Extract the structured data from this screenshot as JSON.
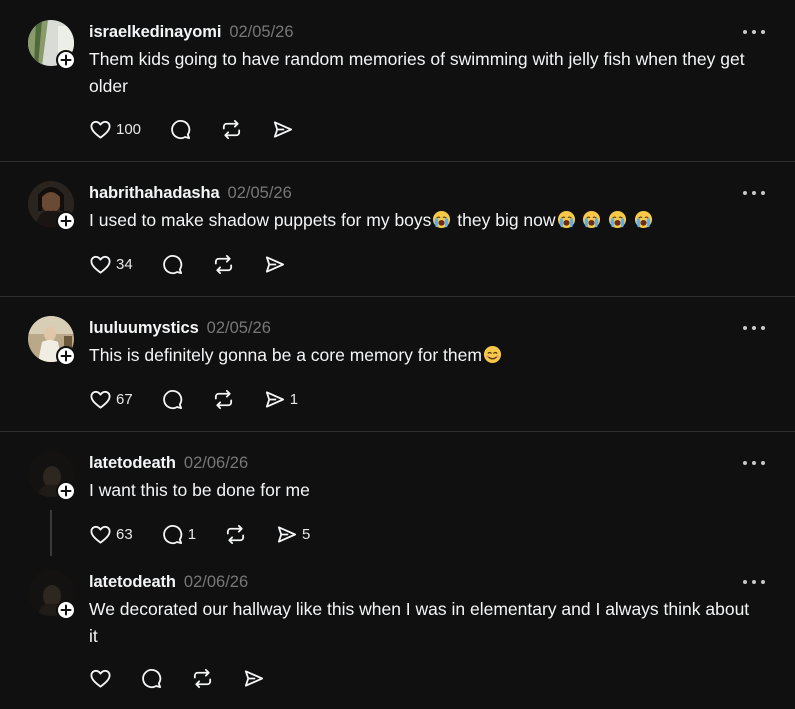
{
  "posts": [
    {
      "username": "israelkedinayomi",
      "date": "02/05/26",
      "text": "Them kids going to have random memories of swimming with jelly fish when they get older",
      "likes": "100",
      "replies": "",
      "reposts": "",
      "shares": ""
    },
    {
      "username": "habrithahadasha",
      "date": "02/05/26",
      "text_a": "I used to make shadow puppets for my boys",
      "text_b": " they big now",
      "likes": "34",
      "replies": "",
      "reposts": "",
      "shares": ""
    },
    {
      "username": "luuluumystics",
      "date": "02/05/26",
      "text": "This is definitely gonna be a core memory for them",
      "likes": "67",
      "replies": "",
      "reposts": "",
      "shares": "1"
    },
    {
      "username": "latetodeath",
      "date": "02/06/26",
      "text": "I want this to be done for me",
      "likes": "63",
      "replies": "1",
      "reposts": "",
      "shares": "5"
    },
    {
      "username": "latetodeath",
      "date": "02/06/26",
      "text": "We decorated our hallway like this when I was in elementary and I always think about it",
      "likes": "",
      "replies": "",
      "reposts": "",
      "shares": ""
    }
  ],
  "icons": {
    "like": "heart-icon",
    "reply": "comment-icon",
    "repost": "repost-icon",
    "share": "send-icon",
    "more": "more-icon",
    "follow": "plus-icon",
    "emoji_cry": "loudly-crying-face-emoji",
    "emoji_smile": "smiling-face-emoji"
  },
  "colors": {
    "background": "#101010",
    "text": "#f3f5f7",
    "muted": "#777777",
    "divider": "#2d2d2d"
  }
}
